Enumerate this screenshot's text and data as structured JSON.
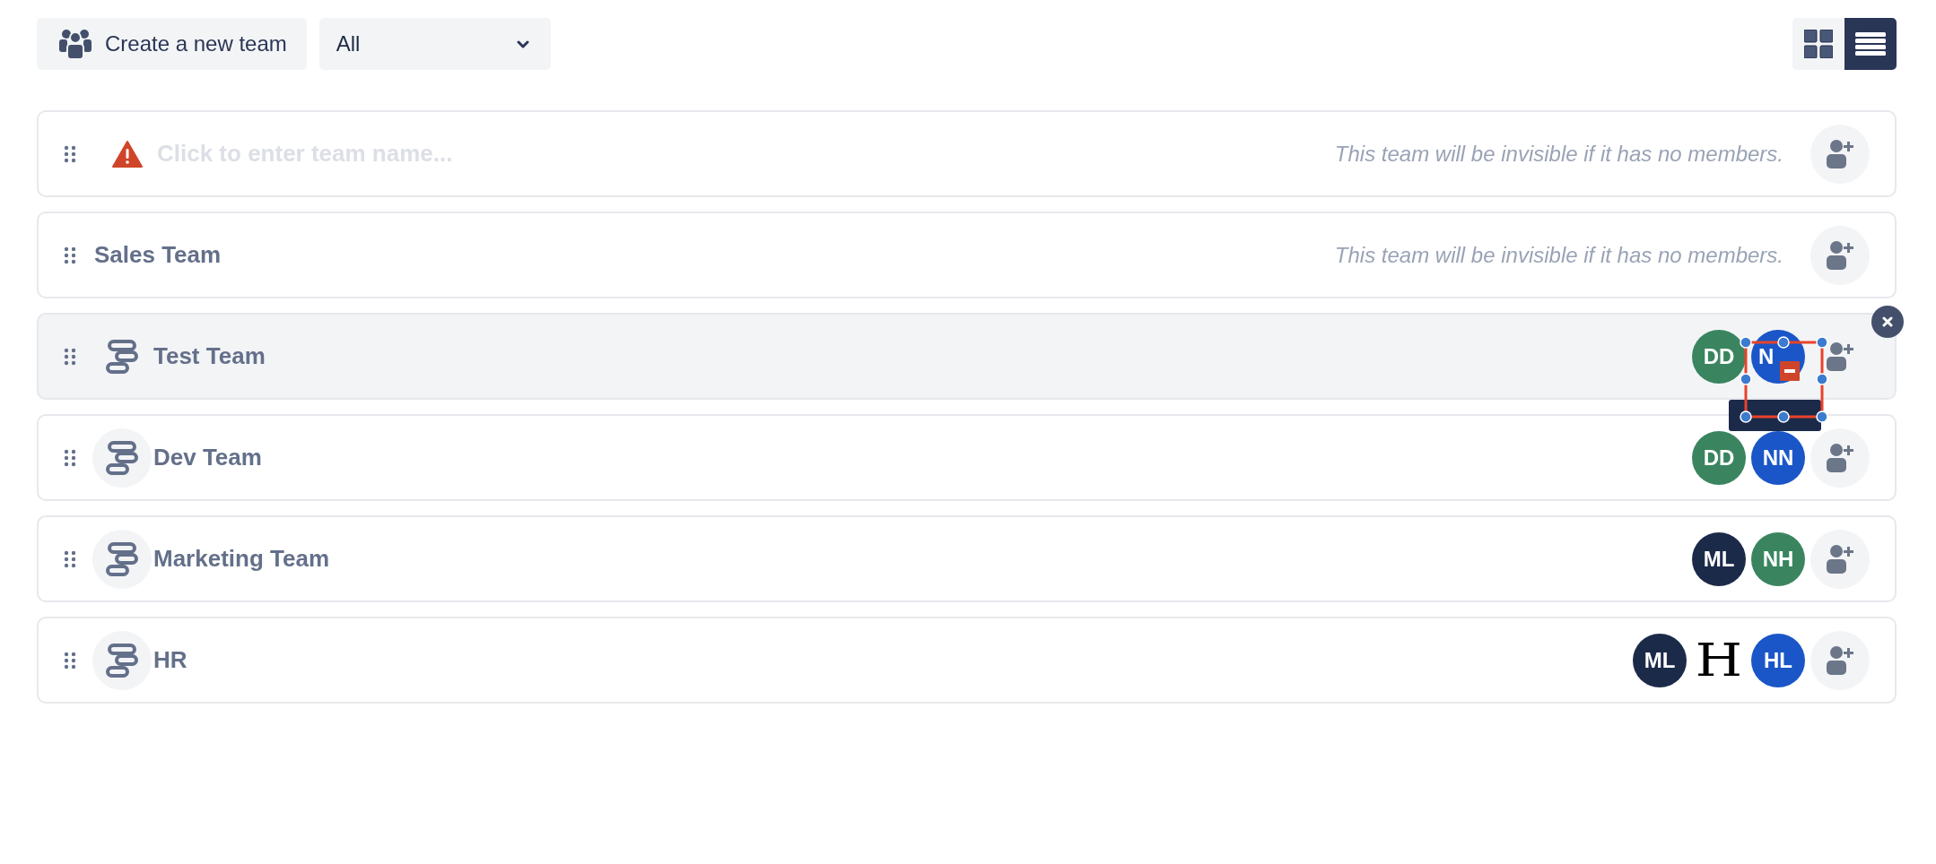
{
  "toolbar": {
    "create_button": "Create a new team",
    "filter": {
      "value": "All"
    },
    "views": [
      {
        "kind": "grid",
        "selected": false
      },
      {
        "kind": "list",
        "selected": true
      }
    ]
  },
  "teams": [
    {
      "kind": "new",
      "name": "Click to enter team name...",
      "note": "This team will be invisible if it has no members.",
      "hovered": false
    },
    {
      "kind": "plain",
      "name": "Sales Team",
      "note": "This team will be invisible if it has no members.",
      "hovered": false
    },
    {
      "kind": "team",
      "name": "Test Team",
      "hovered": true,
      "selection_overlay": true,
      "members": [
        {
          "initials": "DD",
          "color": "#3a8560"
        },
        {
          "initials": "N",
          "color": "#1a56c8"
        }
      ]
    },
    {
      "kind": "team",
      "name": "Dev Team",
      "hovered": false,
      "members": [
        {
          "initials": "DD",
          "color": "#3a8560"
        },
        {
          "initials": "NN",
          "color": "#1a56c8"
        }
      ]
    },
    {
      "kind": "team",
      "name": "Marketing Team",
      "hovered": false,
      "members": [
        {
          "initials": "ML",
          "color": "#1c2a4a"
        },
        {
          "initials": "NH",
          "color": "#3a8560"
        }
      ]
    },
    {
      "kind": "team",
      "name": "HR",
      "hovered": false,
      "members": [
        {
          "initials": "ML",
          "color": "#1c2a4a"
        },
        {
          "initials": "H",
          "kind": "image"
        },
        {
          "initials": "HL",
          "color": "#1a56c8"
        }
      ]
    }
  ]
}
